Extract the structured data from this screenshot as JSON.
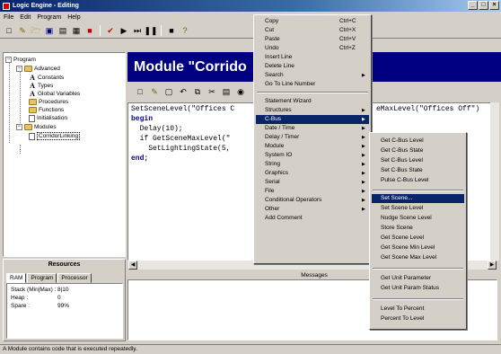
{
  "window": {
    "title": "Logic Engine - Editing",
    "controls": [
      "_",
      "□",
      "×"
    ]
  },
  "menubar": [
    "File",
    "Edit",
    "Program",
    "Help"
  ],
  "toolbar_icons": [
    "new-icon",
    "pen-icon",
    "open-icon",
    "save-icon",
    "print-icon",
    "module-icon",
    "stop-icon",
    "check-icon",
    "run-icon",
    "step-icon",
    "pause-icon",
    "stop-run-icon",
    "help-icon"
  ],
  "tree": {
    "root": "Program",
    "advanced": "Advanced",
    "advanced_items": [
      "Constants",
      "Types",
      "Global Variables",
      "Procedures",
      "Functions",
      "Initialisation"
    ],
    "modules": "Modules",
    "module_items": [
      "CorridorLinking"
    ]
  },
  "resources": {
    "title": "Resources",
    "tabs": [
      "RAM",
      "Program",
      "Processor"
    ],
    "rows": [
      {
        "k": "Stack (Min|Max) :",
        "v": "8|10"
      },
      {
        "k": "Heap :",
        "v": "0"
      },
      {
        "k": "Spare :",
        "v": "99%"
      }
    ]
  },
  "module_header": "Module \"Corrido",
  "code": {
    "line1_a": "SetSceneLevel(\"Offices C",
    "line1_b": "eMaxLevel(\"Offices Off\")",
    "line2": "begin",
    "line3": "  Delay(10);",
    "line4": "  if GetSceneMaxLevel(\"",
    "line5": "    SetLightingState(5,",
    "line6": "end;"
  },
  "messages_title": "Messages",
  "status": "A Module contains code that is executed repeatedly.",
  "context_menu": {
    "items": [
      {
        "label": "Copy",
        "shortcut": "Ctrl+C"
      },
      {
        "label": "Cut",
        "shortcut": "Ctrl+X"
      },
      {
        "label": "Paste",
        "shortcut": "Ctrl+V"
      },
      {
        "label": "Undo",
        "shortcut": "Ctrl+Z"
      },
      {
        "label": "Insert Line",
        "shortcut": ""
      },
      {
        "label": "Delete Line",
        "shortcut": ""
      },
      {
        "label": "Search",
        "shortcut": ""
      },
      {
        "label": "Go To Line Number",
        "shortcut": ""
      },
      {
        "label": "Statement Wizard",
        "shortcut": ""
      },
      {
        "label": "Structures",
        "shortcut": ""
      },
      {
        "label": "C-Bus",
        "shortcut": ""
      },
      {
        "label": "Date / Time",
        "shortcut": ""
      },
      {
        "label": "Delay / Timer",
        "shortcut": ""
      },
      {
        "label": "Module",
        "shortcut": ""
      },
      {
        "label": "System IO",
        "shortcut": ""
      },
      {
        "label": "String",
        "shortcut": ""
      },
      {
        "label": "Graphics",
        "shortcut": ""
      },
      {
        "label": "Serial",
        "shortcut": ""
      },
      {
        "label": "File",
        "shortcut": ""
      },
      {
        "label": "Conditional Operators",
        "shortcut": ""
      },
      {
        "label": "Other",
        "shortcut": ""
      },
      {
        "label": "Add Comment",
        "shortcut": ""
      }
    ]
  },
  "cbus_submenu": {
    "items": [
      "Get C-Bus Level",
      "Get C-Bus State",
      "Set C-Bus Level",
      "Set C-Bus State",
      "Pulse C-Bus Level",
      "Set Scene...",
      "Set Scene Level",
      "Nudge Scene Level",
      "Store Scene",
      "Get Scene Level",
      "Get Scene Min Level",
      "Get Scene Max Level",
      "Get Unit Parameter",
      "Get Unit Param Status",
      "Level To Percent",
      "Percent To Level"
    ]
  }
}
